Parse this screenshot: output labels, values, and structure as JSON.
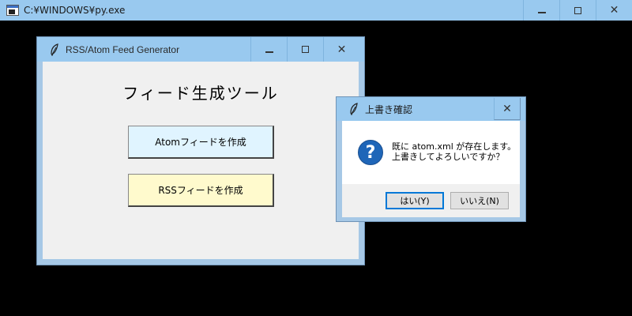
{
  "console": {
    "title": "C:¥WINDOWS¥py.exe",
    "buttons": [
      "minimize",
      "maximize",
      "close"
    ]
  },
  "main_window": {
    "title": "RSS/Atom Feed Generator",
    "heading": "フィード生成ツール",
    "atom_button": "Atomフィードを作成",
    "rss_button": "RSSフィードを作成",
    "colors": {
      "atom_button_bg": "#e0f4ff",
      "rss_button_bg": "#fffacd"
    }
  },
  "dialog": {
    "title": "上書き確認",
    "message_line1": "既に atom.xml が存在します。",
    "message_line2": "上書きしてよろしいですか？",
    "yes_button": "はい(Y)",
    "no_button": "いいえ(N)",
    "icon": "question-icon"
  }
}
